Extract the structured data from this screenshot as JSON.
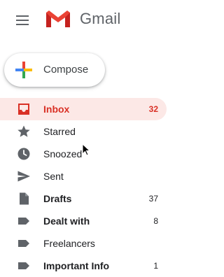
{
  "brand": {
    "name": "Gmail"
  },
  "compose": {
    "label": "Compose"
  },
  "nav": {
    "items": [
      {
        "label": "Inbox",
        "count": "32",
        "icon": "inbox-icon"
      },
      {
        "label": "Starred",
        "count": "",
        "icon": "star-icon"
      },
      {
        "label": "Snoozed",
        "count": "",
        "icon": "clock-icon"
      },
      {
        "label": "Sent",
        "count": "",
        "icon": "send-icon"
      },
      {
        "label": "Drafts",
        "count": "37",
        "icon": "draft-icon"
      },
      {
        "label": "Dealt with",
        "count": "8",
        "icon": "label-icon"
      },
      {
        "label": "Freelancers",
        "count": "",
        "icon": "label-icon"
      },
      {
        "label": "Important Info",
        "count": "1",
        "icon": "label-icon"
      }
    ]
  },
  "colors": {
    "active_bg": "#fce8e6",
    "active_text": "#d93025",
    "icon_gray": "#5f6368"
  }
}
